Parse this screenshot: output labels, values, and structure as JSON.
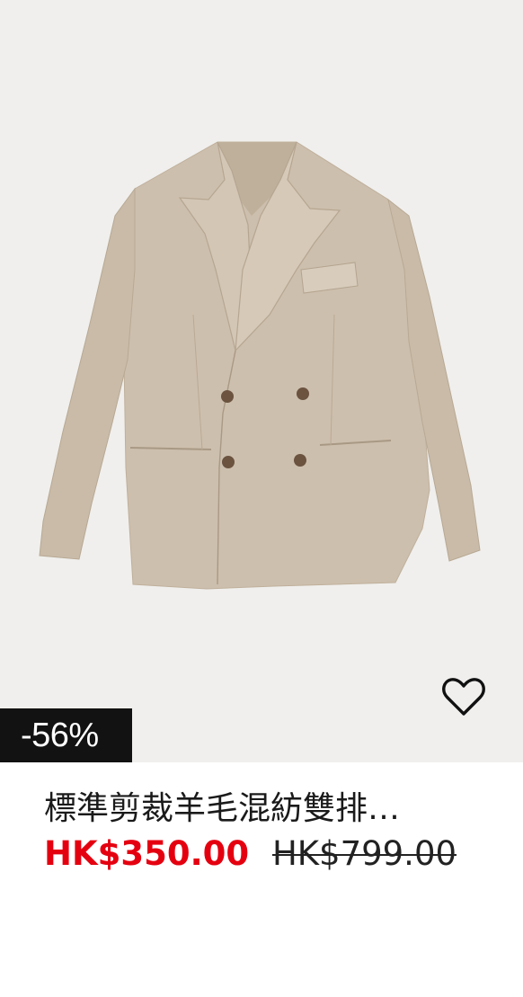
{
  "product": {
    "image_alt": "Beige double-breasted blazer",
    "discount_badge": "-56%",
    "title": "標準剪裁羊毛混紡雙排…",
    "sale_price": "HK$350.00",
    "original_price": "HK$799.00",
    "favorite_icon": "heart-outline-icon"
  },
  "colors": {
    "sale": "#e50010",
    "badge_bg": "#121212",
    "image_bg": "#f0efed",
    "fabric": "#cdbfad"
  }
}
